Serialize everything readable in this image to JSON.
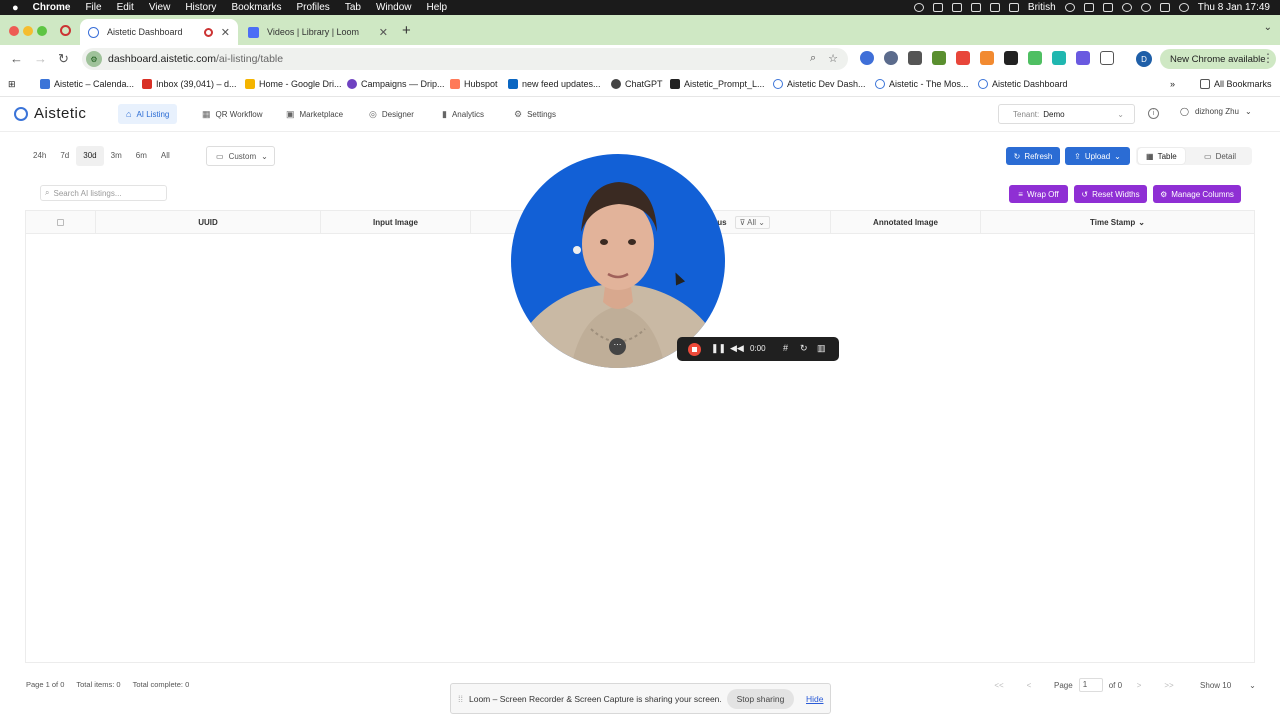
{
  "menubar": {
    "apple": "",
    "app_name": "Chrome",
    "menus": [
      "File",
      "Edit",
      "View",
      "History",
      "Bookmarks",
      "Profiles",
      "Tab",
      "Window",
      "Help"
    ],
    "keyboard": "British",
    "datetime": "Thu 8 Jan  17:49"
  },
  "tabs": [
    {
      "title": "Aistetic Dashboard",
      "active": true
    },
    {
      "title": "Videos | Library | Loom",
      "active": false
    }
  ],
  "address": {
    "host": "dashboard.aistetic.com",
    "path": "/ai-listing/table",
    "new_chrome": "New Chrome available",
    "profile_letter": "D"
  },
  "bookmarks": [
    "Aistetic – Calenda...",
    "Inbox (39,041) – d...",
    "Home - Google Dri...",
    "Campaigns — Drip...",
    "Hubspot",
    "new feed updates...",
    "ChatGPT",
    "Aistetic_Prompt_L...",
    "Aistetic Dev Dash...",
    "Aistetic - The Mos...",
    "Aistetic Dashboard"
  ],
  "bookmarks_all": "All Bookmarks",
  "app": {
    "logo": "Aistetic",
    "nav": [
      "AI Listing",
      "QR Workflow",
      "Marketplace",
      "Designer",
      "Analytics",
      "Settings"
    ],
    "tenant_label": "Tenant:",
    "tenant_value": "Demo",
    "user": "dizhong Zhu"
  },
  "toolbar": {
    "ranges": [
      "24h",
      "7d",
      "30d",
      "3m",
      "6m",
      "All"
    ],
    "active_range": "30d",
    "custom": "Custom",
    "refresh": "Refresh",
    "upload": "Upload",
    "view_table": "Table",
    "view_detail": "Detail",
    "search_placeholder": "Search AI listings...",
    "wrap_off": "Wrap Off",
    "reset_widths": "Reset Widths",
    "manage_columns": "Manage Columns"
  },
  "table": {
    "columns": [
      "UUID",
      "Input Image",
      "Status",
      "Annotated Image",
      "Time Stamp"
    ],
    "status_filter": "All"
  },
  "footer": {
    "page_info": "Page 1 of 0",
    "total_items": "Total items: 0",
    "total_complete": "Total complete: 0",
    "page_label": "Page",
    "page_value": "1",
    "of_label": "of 0",
    "show": "Show 10",
    "first": "<<",
    "prev": "<",
    "next": ">",
    "last": ">>"
  },
  "loom": {
    "timer": "0:00",
    "share_message": "Loom – Screen Recorder & Screen Capture is sharing your screen.",
    "stop_sharing": "Stop sharing",
    "hide": "Hide"
  },
  "colors": {
    "primary": "#2b6cd4",
    "purple": "#8f2fd4",
    "tab_strip": "#cfe8c4",
    "loom_bubble": "#1260d6",
    "record_red": "#ee4a3a"
  }
}
